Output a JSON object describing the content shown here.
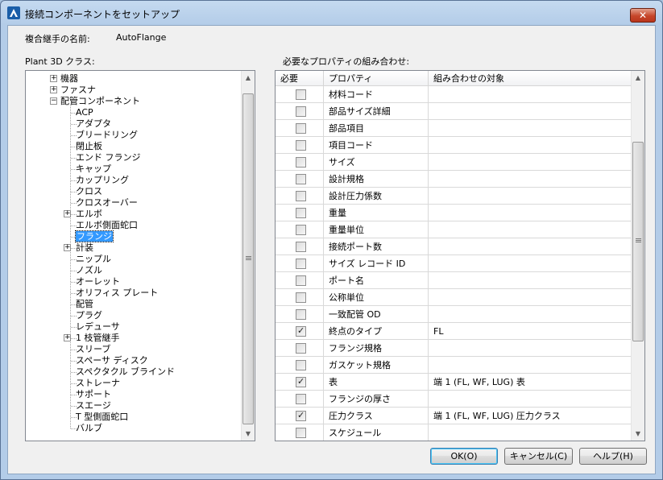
{
  "window": {
    "title": "接続コンポーネントをセットアップ",
    "close_label": "✕"
  },
  "composite_name": {
    "label": "複合継手の名前:",
    "value": "AutoFlange"
  },
  "class_tree": {
    "label": "Plant 3D クラス:",
    "top_nodes": [
      {
        "label": "機器",
        "expander": "+"
      },
      {
        "label": "ファスナ",
        "expander": "+"
      },
      {
        "label": "配管コンポーネント",
        "expander": "−"
      }
    ],
    "children": [
      {
        "label": "ACP",
        "expander": ""
      },
      {
        "label": "アダプタ",
        "expander": ""
      },
      {
        "label": "ブリードリング",
        "expander": ""
      },
      {
        "label": "閉止板",
        "expander": ""
      },
      {
        "label": "エンド フランジ",
        "expander": ""
      },
      {
        "label": "キャップ",
        "expander": ""
      },
      {
        "label": "カップリング",
        "expander": ""
      },
      {
        "label": "クロス",
        "expander": ""
      },
      {
        "label": "クロスオーバー",
        "expander": ""
      },
      {
        "label": "エルボ",
        "expander": "+"
      },
      {
        "label": "エルボ側面蛇口",
        "expander": ""
      },
      {
        "label": "フランジ",
        "expander": "",
        "selected": true
      },
      {
        "label": "計装",
        "expander": "+"
      },
      {
        "label": "ニップル",
        "expander": ""
      },
      {
        "label": "ノズル",
        "expander": ""
      },
      {
        "label": "オーレット",
        "expander": ""
      },
      {
        "label": "オリフィス プレート",
        "expander": ""
      },
      {
        "label": "配管",
        "expander": ""
      },
      {
        "label": "プラグ",
        "expander": ""
      },
      {
        "label": "レデューサ",
        "expander": ""
      },
      {
        "label": "1 枝管継手",
        "expander": "+"
      },
      {
        "label": "スリーブ",
        "expander": ""
      },
      {
        "label": "スペーサ ディスク",
        "expander": ""
      },
      {
        "label": "スペクタクル ブラインド",
        "expander": ""
      },
      {
        "label": "ストレーナ",
        "expander": ""
      },
      {
        "label": "サポート",
        "expander": ""
      },
      {
        "label": "スエージ",
        "expander": ""
      },
      {
        "label": "T 型側面蛇口",
        "expander": ""
      },
      {
        "label": "バルブ",
        "expander": ""
      }
    ]
  },
  "properties": {
    "label": "必要なプロパティの組み合わせ:",
    "columns": [
      "必要",
      "プロパティ",
      "組み合わせの対象"
    ],
    "rows": [
      {
        "required": false,
        "property": "材料コード",
        "target": ""
      },
      {
        "required": false,
        "property": "部品サイズ詳細",
        "target": ""
      },
      {
        "required": false,
        "property": "部品項目",
        "target": ""
      },
      {
        "required": false,
        "property": "項目コード",
        "target": ""
      },
      {
        "required": false,
        "property": "サイズ",
        "target": ""
      },
      {
        "required": false,
        "property": "設計規格",
        "target": ""
      },
      {
        "required": false,
        "property": "設計圧力係数",
        "target": ""
      },
      {
        "required": false,
        "property": "重量",
        "target": ""
      },
      {
        "required": false,
        "property": "重量単位",
        "target": ""
      },
      {
        "required": false,
        "property": "接続ポート数",
        "target": ""
      },
      {
        "required": false,
        "property": "サイズ レコード ID",
        "target": ""
      },
      {
        "required": false,
        "property": "ポート名",
        "target": ""
      },
      {
        "required": false,
        "property": "公称単位",
        "target": ""
      },
      {
        "required": false,
        "property": "一致配管 OD",
        "target": ""
      },
      {
        "required": true,
        "property": "終点のタイプ",
        "target": "FL"
      },
      {
        "required": false,
        "property": "フランジ規格",
        "target": ""
      },
      {
        "required": false,
        "property": "ガスケット規格",
        "target": ""
      },
      {
        "required": true,
        "property": "表",
        "target": "端 1 (FL, WF, LUG) 表"
      },
      {
        "required": false,
        "property": "フランジの厚さ",
        "target": ""
      },
      {
        "required": true,
        "property": "圧力クラス",
        "target": "端 1 (FL, WF, LUG) 圧力クラス"
      },
      {
        "required": false,
        "property": "スケジュール",
        "target": ""
      }
    ]
  },
  "buttons": {
    "ok": "OK(O)",
    "cancel": "キャンセル(C)",
    "help": "ヘルプ(H)"
  }
}
